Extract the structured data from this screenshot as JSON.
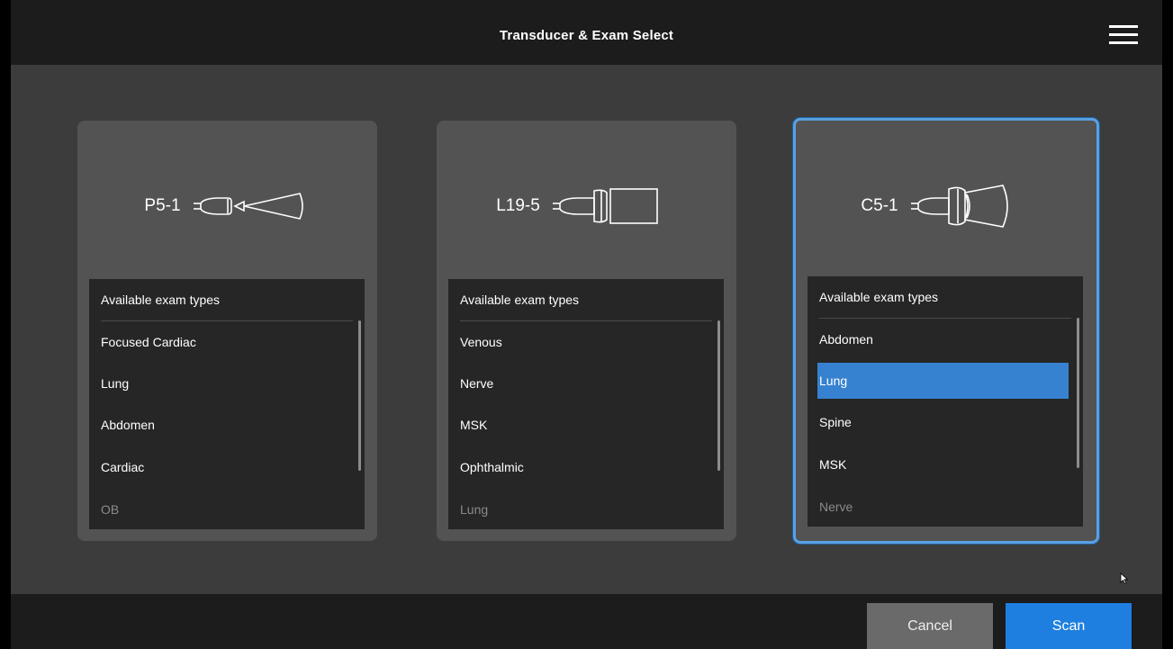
{
  "header": {
    "title": "Transducer & Exam Select",
    "menu_icon": "hamburger-menu-icon"
  },
  "list_heading": "Available exam types",
  "cards": [
    {
      "probe": "P5-1",
      "icon": "phased-array-probe-icon",
      "selected": false,
      "exams": [
        "Focused Cardiac",
        "Lung",
        "Abdomen",
        "Cardiac",
        "OB"
      ]
    },
    {
      "probe": "L19-5",
      "icon": "linear-probe-icon",
      "selected": false,
      "exams": [
        "Venous",
        "Nerve",
        "MSK",
        "Ophthalmic",
        "Lung"
      ]
    },
    {
      "probe": "C5-1",
      "icon": "curved-probe-icon",
      "selected": true,
      "selected_exam": "Lung",
      "exams": [
        "Abdomen",
        "Lung",
        "Spine",
        "MSK",
        "Nerve"
      ]
    }
  ],
  "footer": {
    "cancel_label": "Cancel",
    "scan_label": "Scan"
  },
  "colors": {
    "accent": "#1e7fe0",
    "selected_border": "#5aa0e0",
    "selected_item": "#3682d0"
  }
}
